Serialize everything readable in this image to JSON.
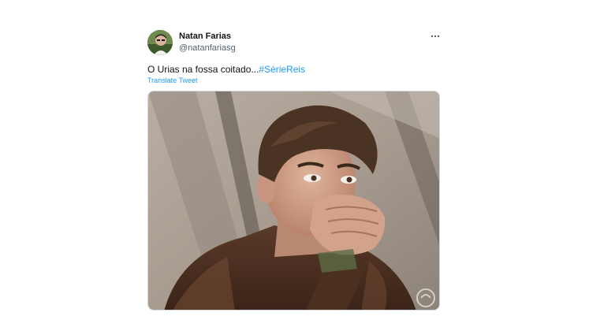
{
  "tweet": {
    "author": {
      "name": "Natan Farias",
      "handle": "@natanfariasg"
    },
    "text": "O Urias na fossa coitado...",
    "hashtag": "#SérieReis",
    "translate_label": "Translate Tweet",
    "more_icon": "more-horizontal-icon",
    "media_description": "Young man with dark hair covering his mouth with his hand, crying, inside a tent"
  },
  "colors": {
    "link": "#1d9bf0",
    "text": "#0f1419",
    "secondary": "#536471"
  }
}
